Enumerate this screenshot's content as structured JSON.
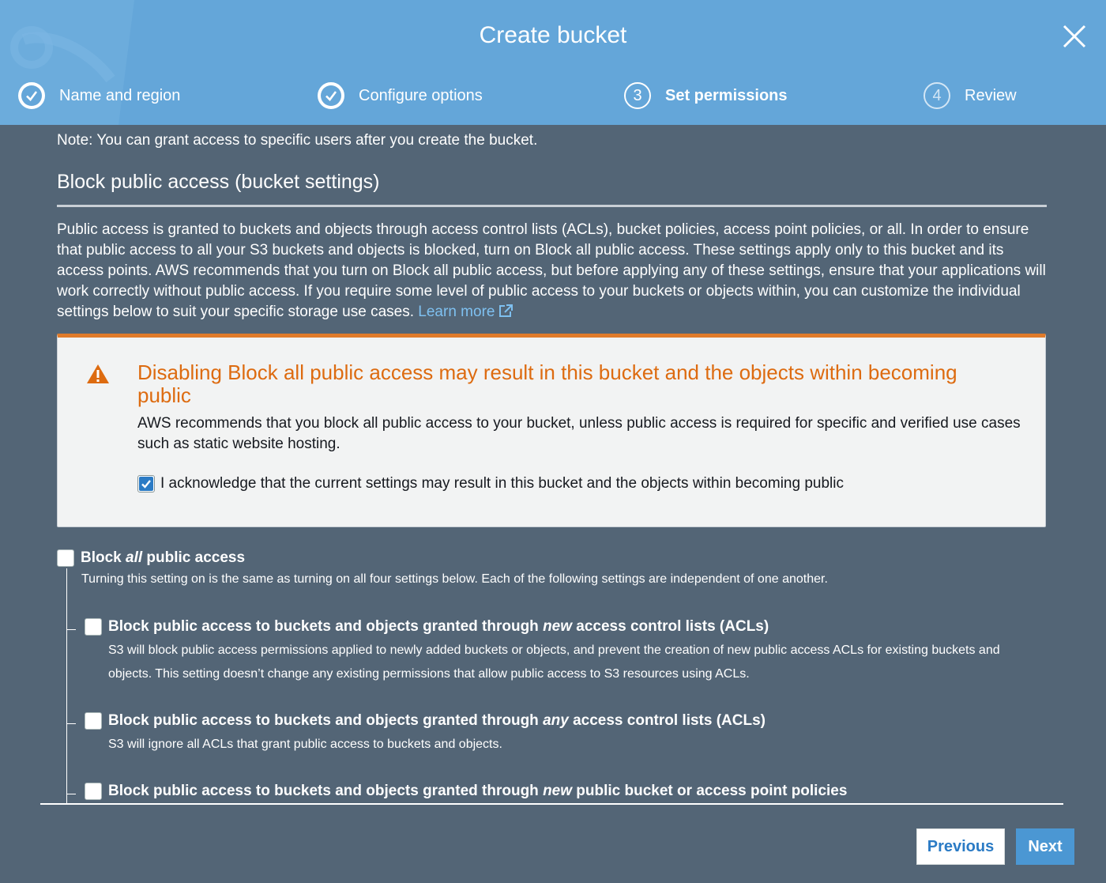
{
  "dialog": {
    "title": "Create bucket",
    "close_icon": "close-icon",
    "accent_color": "#64a6d9"
  },
  "steps": [
    {
      "label": "Name and region",
      "state": "complete",
      "marker": ""
    },
    {
      "label": "Configure options",
      "state": "complete",
      "marker": ""
    },
    {
      "label": "Set permissions",
      "state": "current",
      "marker": "3"
    },
    {
      "label": "Review",
      "state": "pending",
      "marker": "4"
    }
  ],
  "content": {
    "note": "Note: You can grant access to specific users after you create the bucket.",
    "section_title": "Block public access (bucket settings)",
    "intro": "Public access is granted to buckets and objects through access control lists (ACLs), bucket policies, access point policies, or all. In order to ensure that public access to all your S3 buckets and objects is blocked, turn on Block all public access. These settings apply only to this bucket and its access points. AWS recommends that you turn on Block all public access, but before applying any of these settings, ensure that your applications will work correctly without public access. If you require some level of public access to your buckets or objects within, you can customize the individual settings below to suit your specific storage use cases.",
    "learn_more": "Learn more"
  },
  "alert": {
    "title": "Disabling Block all public access may result in this bucket and the objects within becoming public",
    "body": "AWS recommends that you block all public access to your bucket, unless public access is required for specific and verified use cases such as static website hosting.",
    "ack_label": "I acknowledge that the current settings may result in this bucket and the objects within becoming public",
    "ack_checked": true,
    "warning_color": "#dd6b10"
  },
  "block_all": {
    "title_prefix": "Block ",
    "title_em": "all",
    "title_suffix": " public access",
    "checked": false,
    "description": "Turning this setting on is the same as turning on all four settings below. Each of the following settings are independent of one another."
  },
  "sub_options": [
    {
      "title_prefix": "Block public access to buckets and objects granted through ",
      "title_em": "new",
      "title_suffix": " access control lists (ACLs)",
      "checked": false,
      "description": "S3 will block public access permissions applied to newly added buckets or objects, and prevent the creation of new public access ACLs for existing buckets and objects. This setting doesn’t change any existing permissions that allow public access to S3 resources using ACLs."
    },
    {
      "title_prefix": "Block public access to buckets and objects granted through ",
      "title_em": "any",
      "title_suffix": " access control lists (ACLs)",
      "checked": false,
      "description": "S3 will ignore all ACLs that grant public access to buckets and objects."
    },
    {
      "title_prefix": "Block public access to buckets and objects granted through ",
      "title_em": "new",
      "title_suffix": " public bucket or access point policies",
      "checked": false,
      "description": ""
    }
  ],
  "footer": {
    "previous_label": "Previous",
    "next_label": "Next"
  }
}
